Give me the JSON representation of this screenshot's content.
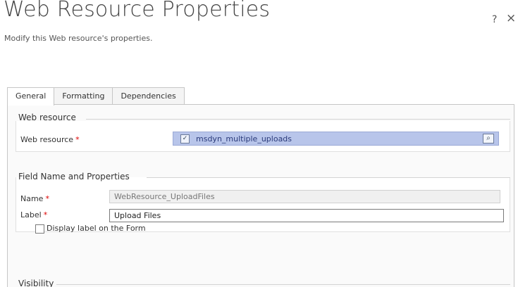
{
  "dialog": {
    "title": "Web Resource Properties",
    "subtitle": "Modify this Web resource's properties.",
    "help_label": "?",
    "close_label": "×"
  },
  "tabs": [
    {
      "label": "General",
      "active": true
    },
    {
      "label": "Formatting",
      "active": false
    },
    {
      "label": "Dependencies",
      "active": false
    }
  ],
  "web_resource_section": {
    "title": "Web resource",
    "field_label": "Web resource",
    "required_marker": "*",
    "value": "msdyn_multiple_uploads"
  },
  "field_section": {
    "title": "Field Name and Properties",
    "name_label": "Name",
    "name_value": "WebResource_UploadFiles",
    "label_label": "Label",
    "label_value": "Upload Files",
    "required_marker": "*",
    "checkbox_label": "Display label on the Form",
    "checkbox_checked": false
  },
  "visibility_section": {
    "title": "Visibility"
  },
  "colors": {
    "lookup_bg": "#b8c5ea",
    "required": "#dd0000"
  },
  "icons": {
    "lookup_item": "web-resource-icon",
    "lookup_search": "lookup-search-icon"
  }
}
